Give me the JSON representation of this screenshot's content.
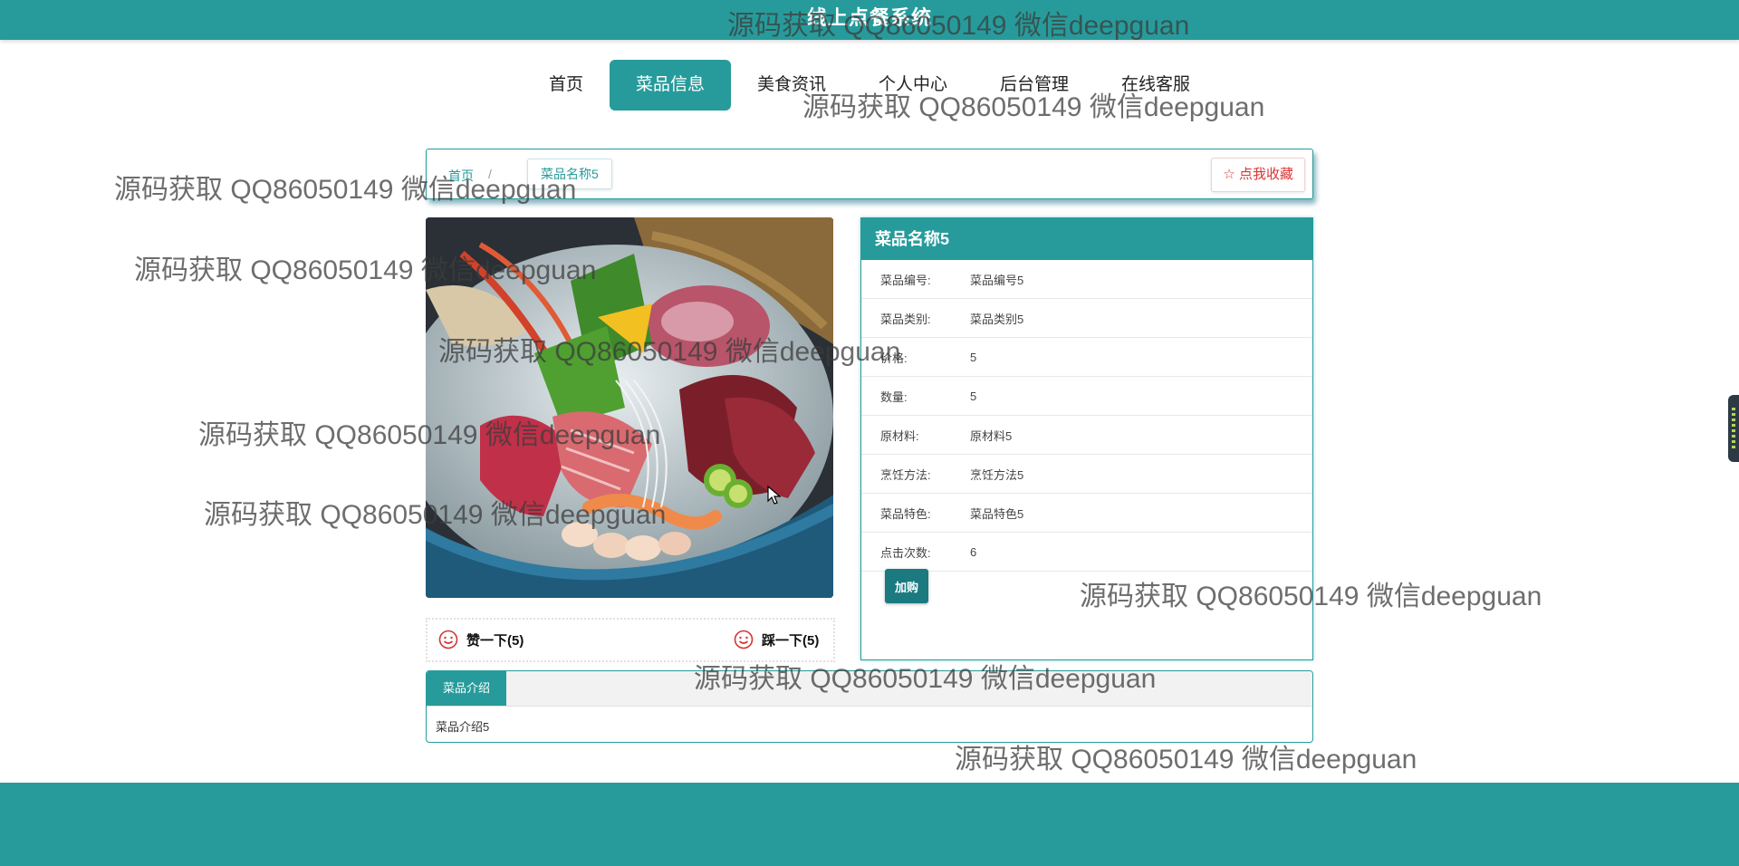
{
  "header": {
    "title": "线上点餐系统"
  },
  "nav": {
    "items": [
      {
        "label": "首页",
        "active": false
      },
      {
        "label": "菜品信息",
        "active": true
      },
      {
        "label": "美食资讯",
        "active": false
      },
      {
        "label": "个人中心",
        "active": false
      },
      {
        "label": "后台管理",
        "active": false
      },
      {
        "label": "在线客服",
        "active": false
      }
    ]
  },
  "breadcrumb": {
    "home": "首页",
    "separator": "/",
    "current": "菜品名称5"
  },
  "favorite": {
    "label": "点我收藏",
    "icon": "star-icon"
  },
  "votes": {
    "up_label": "赞一下(5)",
    "down_label": "踩一下(5)"
  },
  "product": {
    "name": "菜品名称5",
    "rows": [
      {
        "label": "菜品编号:",
        "value": "菜品编号5"
      },
      {
        "label": "菜品类别:",
        "value": "菜品类别5"
      },
      {
        "label": "价格:",
        "value": "5"
      },
      {
        "label": "数量:",
        "value": "5"
      },
      {
        "label": "原材料:",
        "value": "原材料5"
      },
      {
        "label": "烹饪方法:",
        "value": "烹饪方法5"
      },
      {
        "label": "菜品特色:",
        "value": "菜品特色5"
      },
      {
        "label": "点击次数:",
        "value": "6"
      }
    ],
    "add_cart_label": "加购"
  },
  "intro": {
    "tab_label": "菜品介绍",
    "content": "菜品介绍5"
  },
  "watermark_text": "源码获取 QQ86050149 微信deepguan",
  "colors": {
    "primary": "#279b9b",
    "accent_red": "#d33333",
    "button_dark": "#1a7a80"
  }
}
